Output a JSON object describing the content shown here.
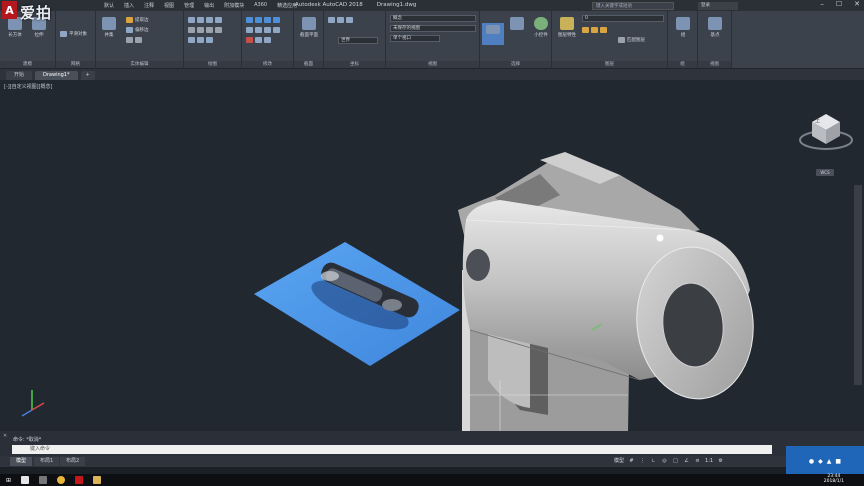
{
  "watermark": "爱拍",
  "app": {
    "logo_letter": "A",
    "title": "Autodesk AutoCAD 2018",
    "document": "Drawing1.dwg",
    "menu": [
      "默认",
      "插入",
      "注释",
      "视图",
      "管理",
      "输出",
      "附加模块",
      "A360",
      "精选应用"
    ],
    "search_placeholder": "键入关键字或短语",
    "signin": "登录",
    "window_controls": [
      "–",
      "☐",
      "✕"
    ]
  },
  "ribbon": {
    "panels": [
      {
        "label": "建模"
      },
      {
        "label": "网格"
      },
      {
        "label": "实体编辑"
      },
      {
        "label": "绘图"
      },
      {
        "label": "修改"
      },
      {
        "label": "截面"
      },
      {
        "label": "坐标"
      },
      {
        "label": "视图"
      },
      {
        "label": "选择"
      },
      {
        "label": "图层"
      },
      {
        "label": "组"
      },
      {
        "label": "视图"
      }
    ],
    "tools": {
      "box": "长方体",
      "extrude": "拉伸",
      "smooth": "平滑对象",
      "union": "并集",
      "extract": "提取边",
      "offset": "偏移边",
      "section_plane": "截面平面",
      "culling": "剔除",
      "gizmo": "小控件",
      "layer_props": "图层特性",
      "match": "匹配图层",
      "group": "组",
      "base": "基点"
    },
    "dropdowns": {
      "visual_style": "概念",
      "view": "未保存的视图",
      "ucs": "世界",
      "viewport": "单个视口",
      "layer": "0"
    }
  },
  "file_tabs": [
    "开始",
    "Drawing1*"
  ],
  "viewport": {
    "label": "[-][自定义视图][概念]",
    "viewcube_face": "上",
    "wcs": "WCS"
  },
  "command": {
    "history": "命令: *取消*",
    "placeholder": "键入命令"
  },
  "layout_tabs": [
    "模型",
    "布局1",
    "布局2"
  ],
  "status": {
    "model": "模型",
    "scale": "1:1"
  },
  "taskbar": {
    "time": "23:44",
    "date": "2018/1/1"
  }
}
